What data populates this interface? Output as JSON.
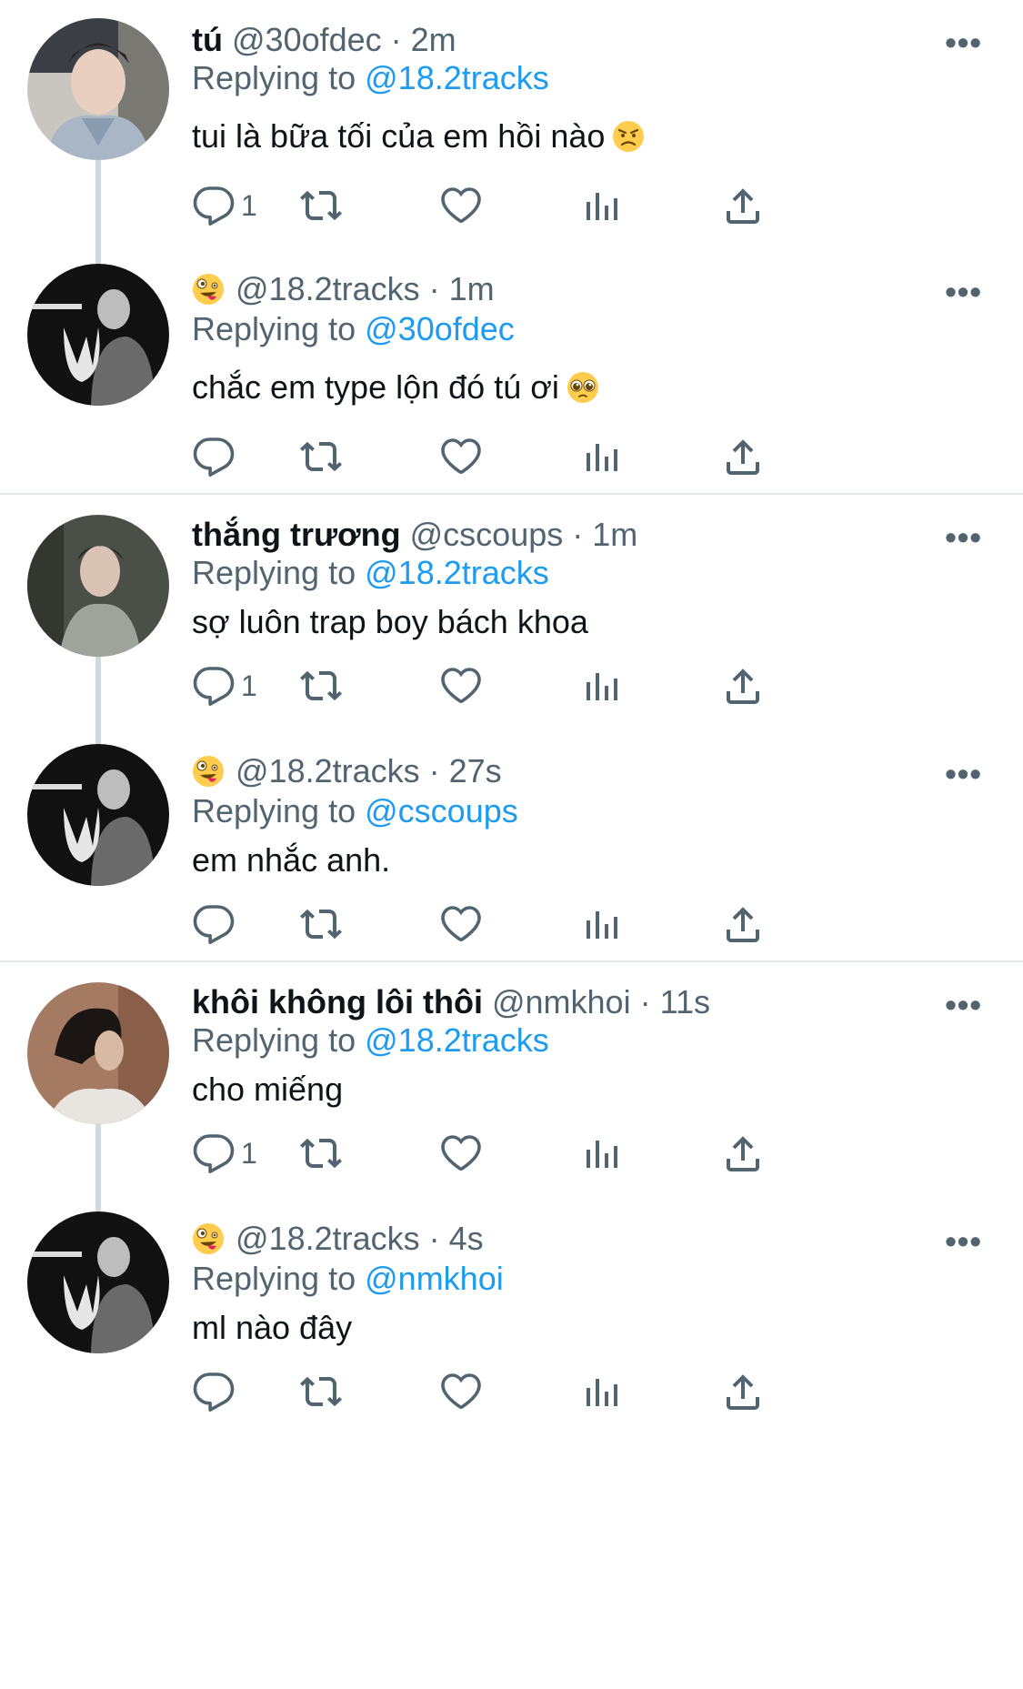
{
  "tweets": [
    {
      "name": "tú",
      "handle": "@30ofdec",
      "time": "· 2m",
      "replying_label": "Replying to",
      "replying_to": "@18.2tracks",
      "text": "tui là bữa tối của em hồi nào",
      "text_emoji": "angry-face-emoji",
      "reply_count": "1",
      "avatar": "photo-avatar-tu"
    },
    {
      "name": "",
      "name_emoji": "zany-face-emoji",
      "handle": "@18.2tracks",
      "time": "· 1m",
      "replying_label": "Replying to",
      "replying_to": "@30ofdec",
      "text": "chắc em type lộn đó tú ơi",
      "text_emoji": "pleading-face-emoji",
      "reply_count": "",
      "avatar": "photo-avatar-18-2tracks"
    },
    {
      "name": "thắng trương",
      "handle": "@cscoups",
      "time": "· 1m",
      "replying_label": "Replying to",
      "replying_to": "@18.2tracks",
      "text": "sợ luôn trap boy bách khoa",
      "reply_count": "1",
      "avatar": "photo-avatar-thang"
    },
    {
      "name": "",
      "name_emoji": "zany-face-emoji",
      "handle": "@18.2tracks",
      "time": "· 27s",
      "replying_label": "Replying to",
      "replying_to": "@cscoups",
      "text": "em nhắc anh.",
      "reply_count": "",
      "avatar": "photo-avatar-18-2tracks"
    },
    {
      "name": "khôi không lôi thôi",
      "handle": "@nmkhoi",
      "time": "· 11s",
      "replying_label": "Replying to",
      "replying_to": "@18.2tracks",
      "text": "cho miếng",
      "reply_count": "1",
      "avatar": "photo-avatar-khoi"
    },
    {
      "name": "",
      "name_emoji": "zany-face-emoji",
      "handle": "@18.2tracks",
      "time": "· 4s",
      "replying_label": "Replying to",
      "replying_to": "@nmkhoi",
      "text": "ml nào đây",
      "reply_count": "",
      "avatar": "photo-avatar-18-2tracks"
    }
  ],
  "icons": {
    "more": "more-horizontal-icon",
    "reply": "reply-bubble-icon",
    "retweet": "retweet-icon",
    "like": "heart-icon",
    "views": "views-bar-chart-icon",
    "share": "share-upload-icon"
  },
  "colors": {
    "link": "#1d9bf0",
    "secondary": "#536471",
    "text": "#0f1419",
    "thread_line": "#cfd9de"
  },
  "more_glyph": "•••"
}
